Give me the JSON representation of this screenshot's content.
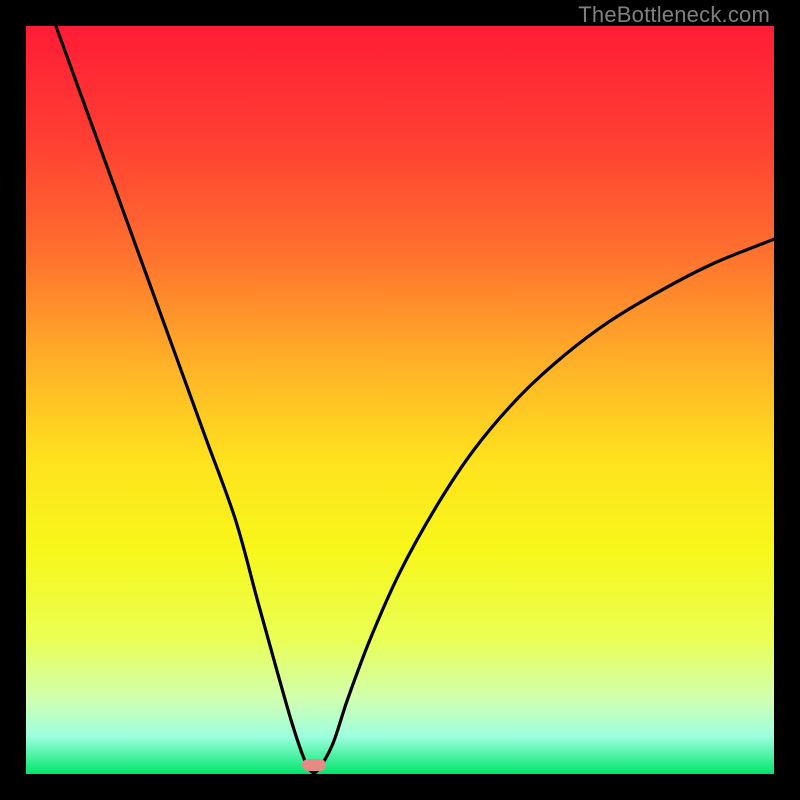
{
  "watermark": "TheBottleneck.com",
  "chart_data": {
    "type": "line",
    "title": "",
    "xlabel": "",
    "ylabel": "",
    "xlim": [
      0,
      100
    ],
    "ylim": [
      0,
      100
    ],
    "gradient_stops": [
      {
        "offset": 0,
        "color": "#ff1c36"
      },
      {
        "offset": 15,
        "color": "#ff3e33"
      },
      {
        "offset": 30,
        "color": "#ff6f2f"
      },
      {
        "offset": 45,
        "color": "#ffb028"
      },
      {
        "offset": 58,
        "color": "#ffe21e"
      },
      {
        "offset": 70,
        "color": "#f7f71a"
      },
      {
        "offset": 82,
        "color": "#eaff55"
      },
      {
        "offset": 90,
        "color": "#d1ffb1"
      },
      {
        "offset": 95,
        "color": "#9cffdf"
      },
      {
        "offset": 100,
        "color": "#00e56a"
      }
    ],
    "series": [
      {
        "name": "bottleneck-curve",
        "x": [
          4,
          8,
          12,
          16,
          20,
          24,
          28,
          31,
          33.5,
          35.5,
          37,
          38,
          39,
          41,
          43,
          46,
          50,
          55,
          60,
          66,
          72,
          78,
          85,
          92,
          100
        ],
        "y": [
          100,
          89,
          78,
          67,
          56,
          45,
          34,
          23,
          14,
          7,
          2.5,
          0.5,
          0.5,
          4,
          10,
          18,
          27,
          36,
          43.5,
          50.5,
          56,
          60.5,
          64.7,
          68.3,
          71.5
        ]
      }
    ],
    "marker": {
      "x": 38.5,
      "y": 1.2,
      "color": "#e58a84"
    }
  }
}
